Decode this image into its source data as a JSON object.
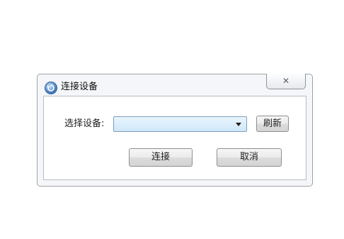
{
  "window": {
    "title": "连接设备",
    "close_label": "✕",
    "app_icon": "connect-app-icon"
  },
  "form": {
    "device_label": "选择设备:",
    "device_select_value": "",
    "refresh_label": "刷新"
  },
  "actions": {
    "connect_label": "连接",
    "cancel_label": "取消"
  }
}
